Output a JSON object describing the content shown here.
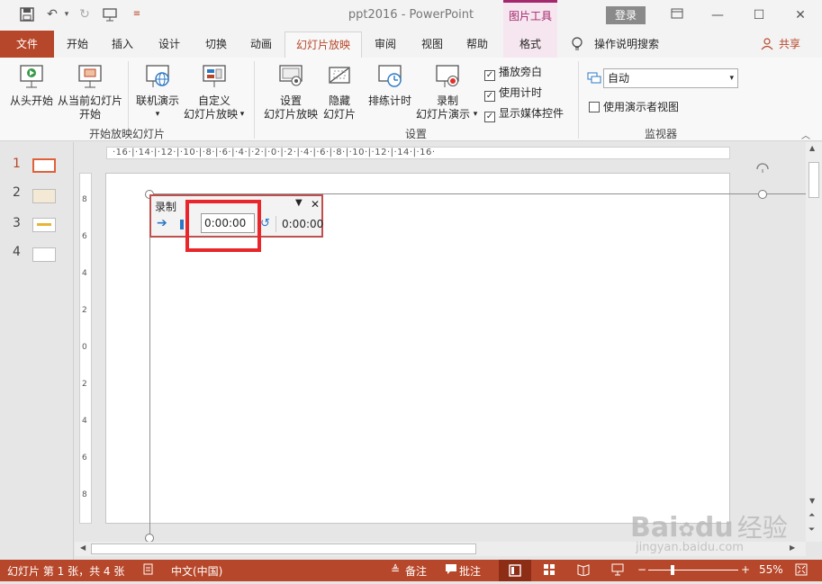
{
  "titlebar": {
    "doc_title": "ppt2016  -  PowerPoint",
    "context_group": "图片工具",
    "login": "登录",
    "minimize": "—",
    "restore": "☐",
    "close": "✕"
  },
  "tabs": {
    "file": "文件",
    "home": "开始",
    "insert": "插入",
    "design": "设计",
    "transitions": "切换",
    "animations": "动画",
    "slideshow": "幻灯片放映",
    "review": "审阅",
    "view": "视图",
    "help": "帮助",
    "format": "格式",
    "tell_me": "操作说明搜索",
    "share": "共享"
  },
  "ribbon": {
    "from_beginning": "从头开始",
    "from_current_1": "从当前幻灯片",
    "from_current_2": "开始",
    "online_present": "联机演示",
    "custom_1": "自定义",
    "custom_2": "幻灯片放映",
    "group_start": "开始放映幻灯片",
    "setup_1": "设置",
    "setup_2": "幻灯片放映",
    "hide_1": "隐藏",
    "hide_2": "幻灯片",
    "rehearse": "排练计时",
    "record_1": "录制",
    "record_2": "幻灯片演示",
    "chk_narration": "播放旁白",
    "chk_timings": "使用计时",
    "chk_media": "显示媒体控件",
    "group_setup": "设置",
    "monitor_value": "自动",
    "presenter_view": "使用演示者视图",
    "group_monitors": "监视器"
  },
  "thumbs": [
    "1",
    "2",
    "3",
    "4"
  ],
  "ruler_h": "·16·|·14·|·12·|·10·|·8·|·6·|·4·|·2·|·0·|·2·|·4·|·6·|·8·|·10·|·12·|·14·|·16·",
  "ruler_v": [
    "8",
    "6",
    "4",
    "2",
    "0",
    "2",
    "4",
    "6",
    "8"
  ],
  "rec_toolbar": {
    "title": "录制",
    "slide_time": "0:00:00",
    "total_time": "0:00:00"
  },
  "statusbar": {
    "slide_info": "幻灯片 第 1 张，共 4 张",
    "language": "中文(中国)",
    "notes": "备注",
    "comments": "批注",
    "zoom": "55%"
  },
  "watermark": {
    "brand": "Bai",
    "brand2": "du",
    "cn": "经验",
    "url": "jingyan.baidu.com"
  }
}
